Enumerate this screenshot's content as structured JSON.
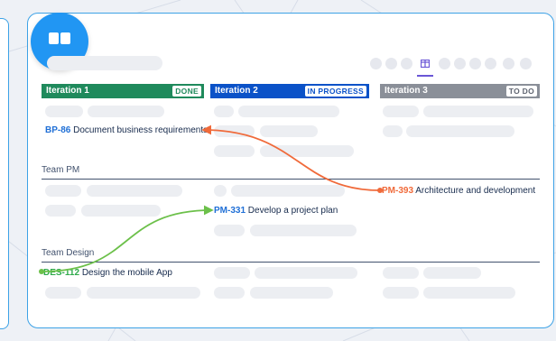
{
  "board": {
    "iterations": [
      {
        "name": "Iteration 1",
        "status": "DONE",
        "color": "#1f8a5c",
        "status_color": "#1f8a5c"
      },
      {
        "name": "Iteration 2",
        "status": "IN PROGRESS",
        "color": "#0b52c8",
        "status_color": "#0b52c8"
      },
      {
        "name": "Iteration 3",
        "status": "TO DO",
        "color": "#8a8f98",
        "status_color": "#5e6470"
      }
    ],
    "teams": {
      "pm": "Team PM",
      "design": "Team Design"
    },
    "issues": {
      "bp86": {
        "key": "BP-86",
        "title": "Document business requirements"
      },
      "pm393": {
        "key": "PM-393",
        "title": "Architecture and development"
      },
      "pm331": {
        "key": "PM-331",
        "title": "Develop a project plan"
      },
      "des112": {
        "key": "DES-112",
        "title": "Design the mobile App"
      }
    },
    "dependency_colors": {
      "red": "#f06a3a",
      "green": "#6cc04a"
    }
  },
  "icons": {
    "badge": "board-view-icon",
    "view": "board-columns-icon"
  }
}
